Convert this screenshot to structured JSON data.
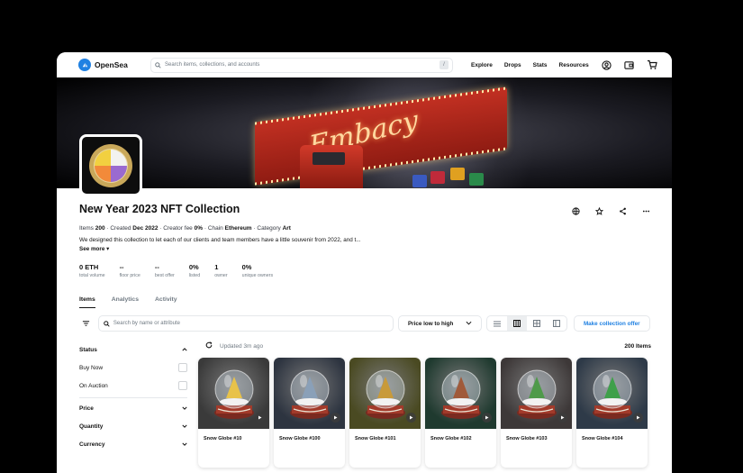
{
  "header": {
    "brand": "OpenSea",
    "search_placeholder": "Search items, collections, and accounts",
    "search_shortcut": "/",
    "nav": [
      "Explore",
      "Drops",
      "Stats",
      "Resources"
    ]
  },
  "banner": {
    "truck_text": "Embacy"
  },
  "collection": {
    "title": "New Year 2023 NFT Collection",
    "meta": {
      "items_label": "Items",
      "items_value": "200",
      "created_label": "Created",
      "created_value": "Dec 2022",
      "fee_label": "Creator fee",
      "fee_value": "0%",
      "chain_label": "Chain",
      "chain_value": "Ethereum",
      "category_label": "Category",
      "category_value": "Art"
    },
    "description": "We designed this collection to let each of our clients and team members have a little souvenir from 2022, and t...",
    "see_more": "See more",
    "stats": [
      {
        "value": "0 ETH",
        "label": "total volume"
      },
      {
        "value": "--",
        "label": "floor price"
      },
      {
        "value": "--",
        "label": "best offer"
      },
      {
        "value": "0%",
        "label": "listed"
      },
      {
        "value": "1",
        "label": "owner"
      },
      {
        "value": "0%",
        "label": "unique owners"
      }
    ],
    "tabs": [
      "Items",
      "Analytics",
      "Activity"
    ]
  },
  "toolbar": {
    "search_placeholder": "Search by name or attribute",
    "sort_label": "Price low to high",
    "offer_label": "Make collection offer"
  },
  "sidebar": {
    "status_label": "Status",
    "status_options": [
      "Buy Now",
      "On Auction"
    ],
    "price_label": "Price",
    "quantity_label": "Quantity",
    "currency_label": "Currency"
  },
  "results": {
    "updated": "Updated 3m ago",
    "count": "200 Items",
    "items": [
      {
        "name": "Snow Globe #10",
        "bg": "#3a3a3a",
        "tree": "#e8c24a"
      },
      {
        "name": "Snow Globe #100",
        "bg": "#2d3440",
        "tree": "#8aa0b8"
      },
      {
        "name": "Snow Globe #101",
        "bg": "#4a4a22",
        "tree": "#c89a3a"
      },
      {
        "name": "Snow Globe #102",
        "bg": "#1f3a2f",
        "tree": "#a05a3a"
      },
      {
        "name": "Snow Globe #103",
        "bg": "#3d3838",
        "tree": "#4f9a4a"
      },
      {
        "name": "Snow Globe #104",
        "bg": "#2e3a48",
        "tree": "#3fa04a"
      }
    ]
  }
}
